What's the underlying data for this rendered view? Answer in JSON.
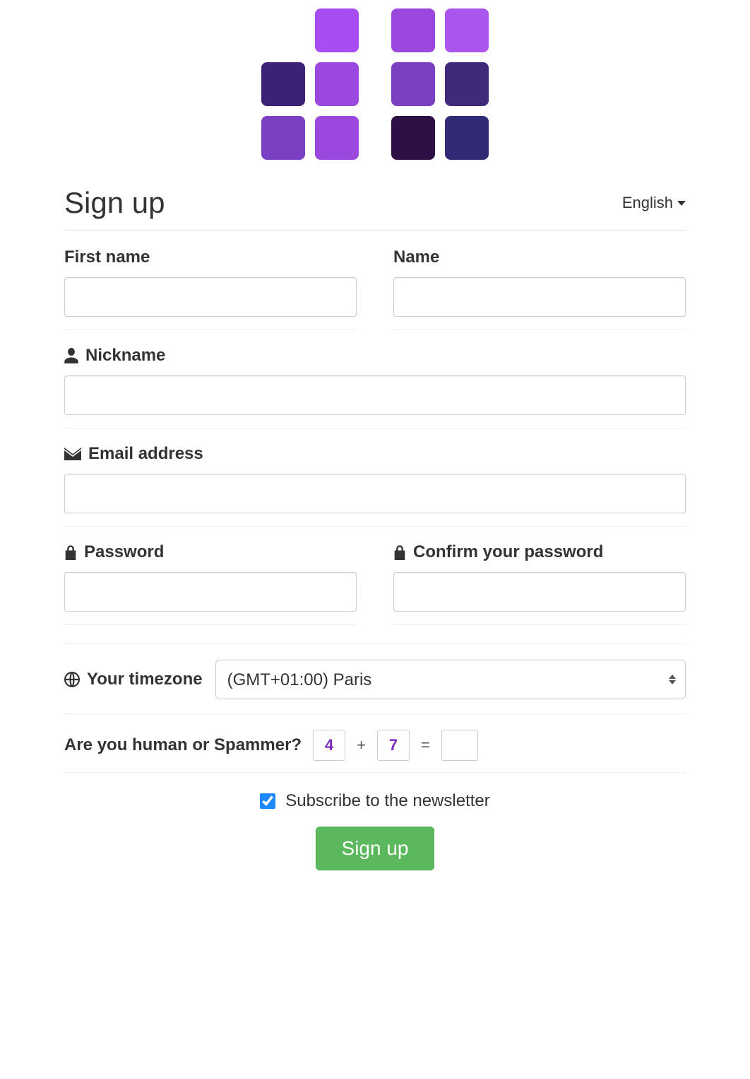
{
  "logo_colors": {
    "r1c2": "#a84df2",
    "r1c4": "#9b48df",
    "r1c5": "#aa55ee",
    "r2c1": "#3d2177",
    "r2c2": "#9b48df",
    "r2c4": "#7a3fc2",
    "r2c5": "#3e2a78",
    "r3c1": "#7a3fc2",
    "r3c2": "#9b48df",
    "r3c4": "#2e1046",
    "r3c5": "#312a74"
  },
  "header": {
    "title": "Sign up",
    "language": "English"
  },
  "fields": {
    "first_name_label": "First name",
    "name_label": "Name",
    "nickname_label": "Nickname",
    "email_label": "Email address",
    "password_label": "Password",
    "confirm_password_label": "Confirm your password",
    "timezone_label": "Your timezone",
    "timezone_value": "(GMT+01:00) Paris"
  },
  "captcha": {
    "question": "Are you human or Spammer?",
    "a": "4",
    "op1": "+",
    "b": "7",
    "op2": "="
  },
  "newsletter": {
    "label": "Subscribe to the newsletter",
    "checked": true
  },
  "submit": {
    "label": "Sign up"
  }
}
